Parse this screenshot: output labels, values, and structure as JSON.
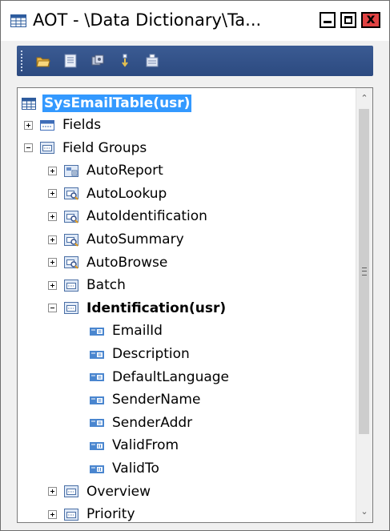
{
  "window": {
    "title": "AOT - \\Data Dictionary\\Ta...",
    "minimize_icon": "minimize-icon",
    "maximize_icon": "maximize-icon",
    "close_symbol": "x"
  },
  "toolbar": {
    "buttons": [
      "open-folder-icon",
      "properties-icon",
      "compile-icon",
      "sort-icon",
      "import-icon"
    ]
  },
  "tree": {
    "root": {
      "label": "SysEmailTable(usr)",
      "icon": "table-icon",
      "selected": true
    },
    "items": [
      {
        "label": "Fields",
        "icon": "fields-icon",
        "expander": "+"
      },
      {
        "label": "Field Groups",
        "icon": "field-groups-icon",
        "expander": "-"
      },
      {
        "label": "AutoReport",
        "icon": "auto-report-icon",
        "expander": "+"
      },
      {
        "label": "AutoLookup",
        "icon": "auto-lookup-icon",
        "expander": "+"
      },
      {
        "label": "AutoIdentification",
        "icon": "auto-lookup-icon",
        "expander": "+"
      },
      {
        "label": "AutoSummary",
        "icon": "auto-lookup-icon",
        "expander": "+"
      },
      {
        "label": "AutoBrowse",
        "icon": "auto-lookup-icon",
        "expander": "+"
      },
      {
        "label": "Batch",
        "icon": "field-group-icon",
        "expander": "+"
      },
      {
        "label": "Identification(usr)",
        "icon": "field-group-icon",
        "expander": "-",
        "bold": true
      },
      {
        "label": "EmailId",
        "icon": "string-field-icon"
      },
      {
        "label": "Description",
        "icon": "string-field-icon"
      },
      {
        "label": "DefaultLanguage",
        "icon": "string-field-icon"
      },
      {
        "label": "SenderName",
        "icon": "string-field-icon"
      },
      {
        "label": "SenderAddr",
        "icon": "string-field-icon"
      },
      {
        "label": "ValidFrom",
        "icon": "date-field-icon"
      },
      {
        "label": "ValidTo",
        "icon": "date-field-icon"
      },
      {
        "label": "Overview",
        "icon": "field-group-icon",
        "expander": "+"
      },
      {
        "label": "Priority",
        "icon": "field-group-icon",
        "expander": "+"
      }
    ]
  },
  "scrollbar": {
    "up_arrow": "^",
    "down_arrow": "v"
  }
}
